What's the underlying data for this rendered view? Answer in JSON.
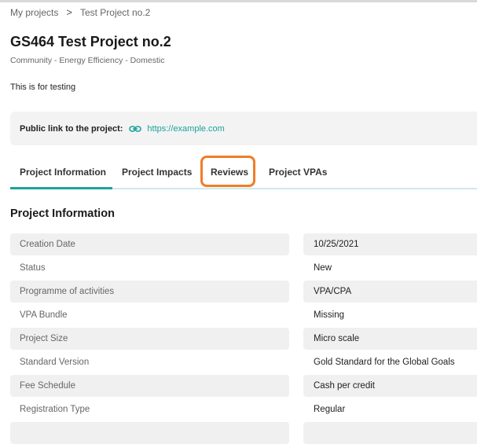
{
  "breadcrumb": {
    "root": "My projects",
    "separator": ">",
    "current": "Test Project no.2"
  },
  "project": {
    "title": "GS464 Test Project no.2",
    "category": "Community - Energy Efficiency - Domestic",
    "description": "This is for testing"
  },
  "public_link": {
    "label": "Public link to the project:",
    "url": "https://example.com",
    "icon": "link-icon"
  },
  "tabs": [
    {
      "label": "Project Information",
      "active": true
    },
    {
      "label": "Project Impacts",
      "active": false
    },
    {
      "label": "Reviews",
      "active": false,
      "highlighted": true
    },
    {
      "label": "Project VPAs",
      "active": false
    }
  ],
  "section": {
    "title": "Project Information"
  },
  "rows": [
    {
      "label": "Creation Date",
      "value": "10/25/2021"
    },
    {
      "label": "Status",
      "value": "New"
    },
    {
      "label": "Programme of activities",
      "value": "VPA/CPA"
    },
    {
      "label": "VPA Bundle",
      "value": "Missing"
    },
    {
      "label": "Project Size",
      "value": "Micro scale"
    },
    {
      "label": "Standard Version",
      "value": "Gold Standard for the Global Goals"
    },
    {
      "label": "Fee Schedule",
      "value": "Cash per credit"
    },
    {
      "label": "Registration Type",
      "value": "Regular"
    }
  ],
  "colors": {
    "accent": "#1ba39c",
    "highlight": "#f07d27",
    "row_shade": "#f0f0f0"
  }
}
